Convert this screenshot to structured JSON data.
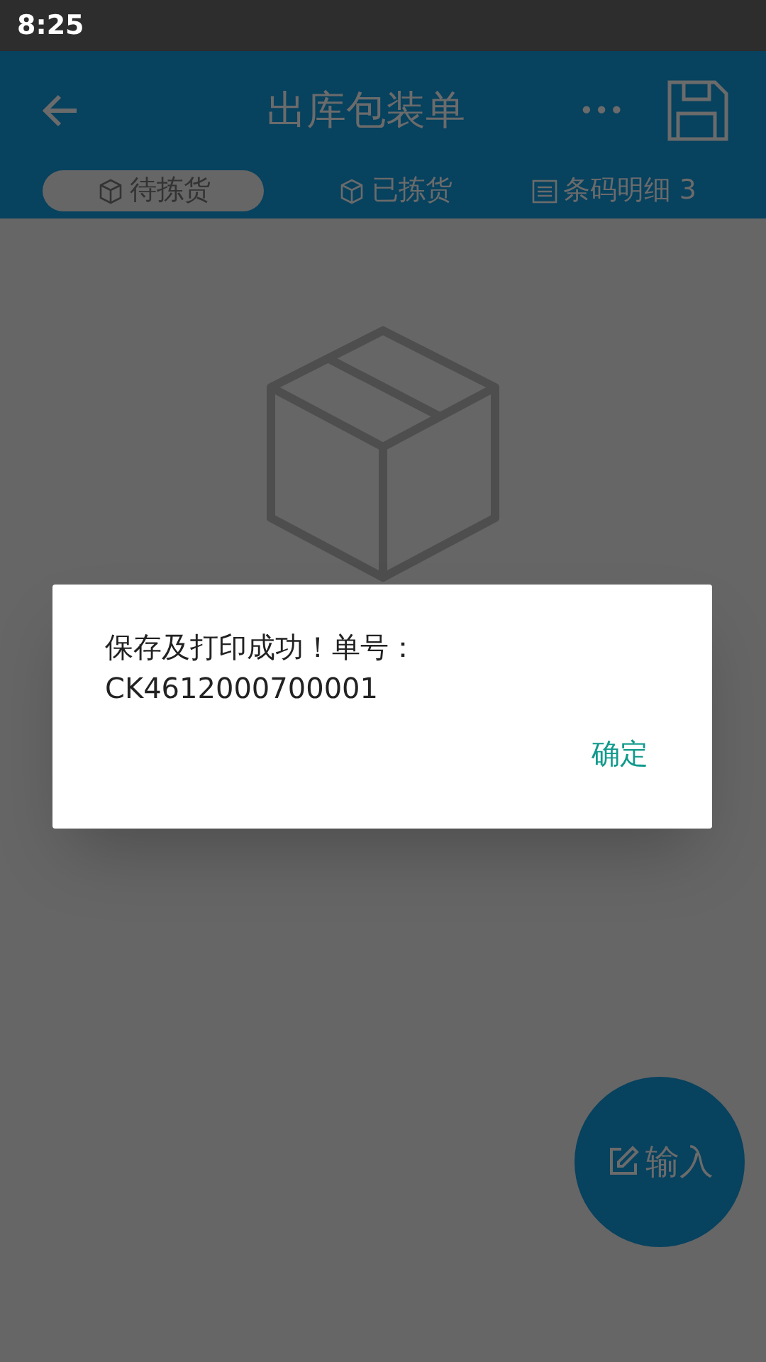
{
  "status_bar": {
    "time": "8:25"
  },
  "header": {
    "title": "出库包装单",
    "more": "•••"
  },
  "tabs": [
    {
      "label": "待拣货",
      "selected": true
    },
    {
      "label": "已拣货",
      "selected": false
    },
    {
      "label": "条码明细 3",
      "selected": false
    }
  ],
  "dialog": {
    "message": "保存及打印成功！单号：",
    "order_no": "CK4612000700001",
    "button": "确定"
  },
  "fab": {
    "label": "输入"
  }
}
